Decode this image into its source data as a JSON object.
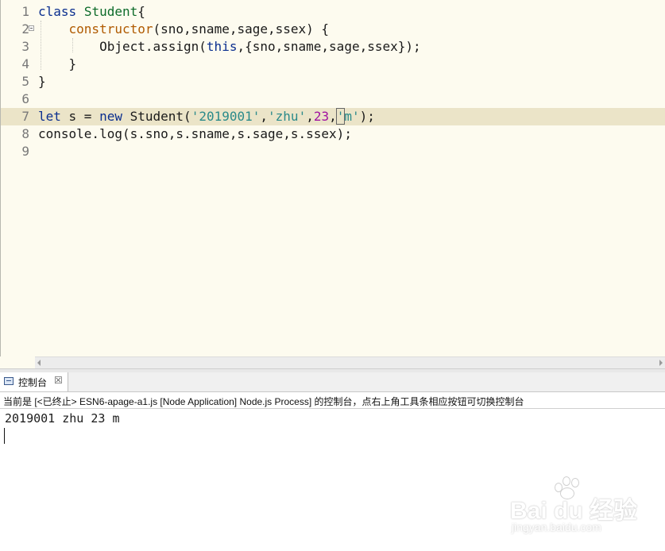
{
  "editor": {
    "lines": [
      {
        "no": "1"
      },
      {
        "no": "2"
      },
      {
        "no": "3"
      },
      {
        "no": "4"
      },
      {
        "no": "5"
      },
      {
        "no": "6"
      },
      {
        "no": "7"
      },
      {
        "no": "8"
      },
      {
        "no": "9"
      }
    ],
    "code": {
      "l1_kw": "class",
      "l1_cls": "Student",
      "l1_brace": "{",
      "l2_fn": "constructor",
      "l2_rest": "(sno,sname,sage,ssex) {",
      "l3_obj": "Object.assign(",
      "l3_this": "this",
      "l3_rest": ",{sno,sname,sage,ssex});",
      "l4": "}",
      "l5": "}",
      "l7_let": "let",
      "l7_s": " s = ",
      "l7_new": "new",
      "l7_call": " Student(",
      "l7_str1": "'2019001'",
      "l7_c1": ",",
      "l7_str2": "'zhu'",
      "l7_c2": ",",
      "l7_num": "23",
      "l7_c3": ",",
      "l7_q": "'",
      "l7_m": "m'",
      "l7_end": ");",
      "l8": "console.log(s.sno,s.sname,s.sage,s.ssex);"
    },
    "current_line": 7
  },
  "console": {
    "tab_label": "控制台",
    "tab_close": "☒",
    "status": "当前是 [<已终止> ESN6-apage-a1.js [Node Application] Node.js Process] 的控制台，点右上角工具条相应按钮可切换控制台",
    "output": "2019001 zhu 23 m"
  },
  "watermark": {
    "logo": "Bai du 经验",
    "sub": "jingyan.baidu.com"
  },
  "colors": {
    "keyword": "#0b2f8f",
    "class_name": "#0d6b2a",
    "function": "#b05a00",
    "string": "#2a8a8a",
    "number": "#a012a0",
    "current_line_bg": "#ebe4c8",
    "editor_bg": "#fdfbef"
  }
}
